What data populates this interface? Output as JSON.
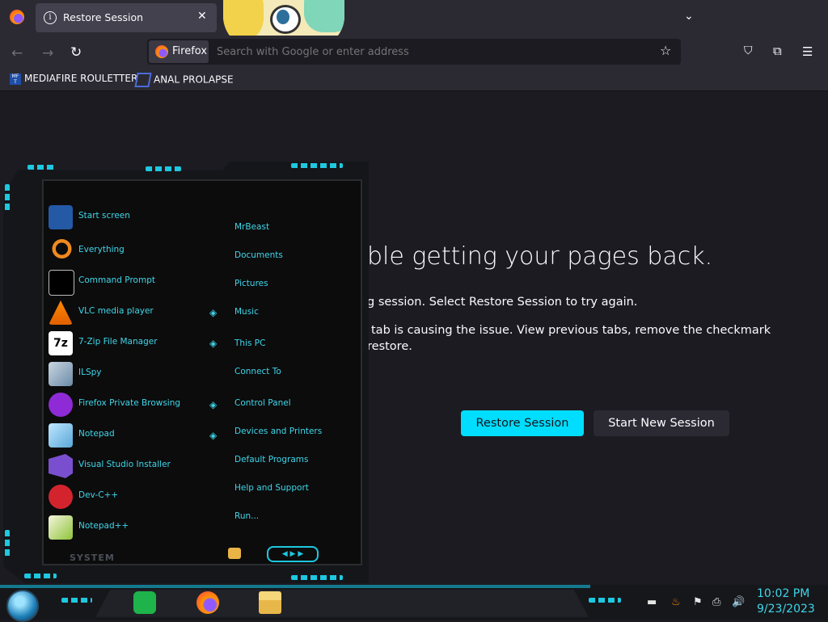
{
  "browser": {
    "tab_title": "Restore Session",
    "tab_icon": "info-icon",
    "identity_label": "Firefox",
    "url_placeholder": "Search with Google or enter address",
    "bookmarks": [
      {
        "label": "MEDIAFIRE ROULETTER",
        "icon": "mediafire-icon"
      },
      {
        "label": "ANAL PROLAPSE",
        "icon": "bookmark-icon"
      }
    ]
  },
  "page": {
    "heading_visible": "ble getting your pages back.",
    "para1_visible": "g session. Select Restore Session to try again.",
    "para2_line1_visible": "tab is causing the issue. View previous tabs, remove the checkmark",
    "para2_line2_visible": "restore.",
    "restore_button": "Restore Session",
    "new_session_button": "Start New Session",
    "accent_color": "#00ddff"
  },
  "start_menu": {
    "left_items": [
      {
        "label": "Start screen",
        "icon": "start-screen-icon"
      },
      {
        "label": "Everything",
        "icon": "everything-search-icon"
      },
      {
        "label": "Command Prompt",
        "icon": "command-prompt-icon"
      },
      {
        "label": "VLC media player",
        "icon": "vlc-icon"
      },
      {
        "label": "7-Zip File Manager",
        "icon": "7zip-icon"
      },
      {
        "label": "ILSpy",
        "icon": "ilspy-icon"
      },
      {
        "label": "Firefox Private Browsing",
        "icon": "firefox-private-icon"
      },
      {
        "label": "Notepad",
        "icon": "notepad-icon"
      },
      {
        "label": "Visual Studio Installer",
        "icon": "visual-studio-installer-icon"
      },
      {
        "label": "Dev-C++",
        "icon": "dev-cpp-icon"
      },
      {
        "label": "Notepad++",
        "icon": "notepad-plus-plus-icon"
      }
    ],
    "right_items": [
      {
        "label": "MrBeast",
        "has_arrow": false
      },
      {
        "label": "Documents",
        "has_arrow": false
      },
      {
        "label": "Pictures",
        "has_arrow": false
      },
      {
        "label": "Music",
        "has_arrow": true
      },
      {
        "label": "This PC",
        "has_arrow": true
      },
      {
        "label": "Connect To",
        "has_arrow": false
      },
      {
        "label": "Control Panel",
        "has_arrow": true
      },
      {
        "label": "Devices and Printers",
        "has_arrow": true
      },
      {
        "label": "Default Programs",
        "has_arrow": false
      },
      {
        "label": "Help and Support",
        "has_arrow": false
      },
      {
        "label": "Run...",
        "has_arrow": false
      }
    ],
    "system_label": "SYSTEM",
    "theme_color": "#1ec8e0"
  },
  "taskbar": {
    "time": "10:02 PM",
    "date": "9/23/2023",
    "pinned": [
      "notes-app-icon",
      "firefox-icon",
      "file-explorer-icon"
    ],
    "tray": [
      "java-icon",
      "flag-icon",
      "network-icon",
      "volume-icon"
    ]
  }
}
